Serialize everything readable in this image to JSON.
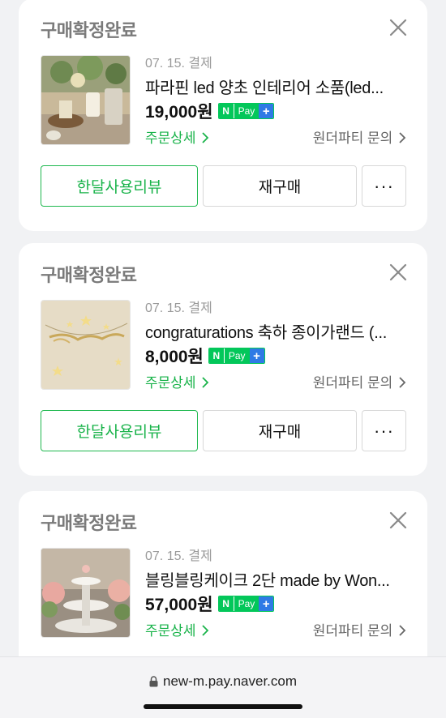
{
  "orders": [
    {
      "status": "구매확정완료",
      "date": "07. 15. 결제",
      "title": "파라핀 led 양초 인테리어 소품(led...",
      "price": "19,000원",
      "detail_link": "주문상세",
      "inquiry_link": "원더파티 문의",
      "review_button": "한달사용리뷰",
      "rebuy_button": "재구매",
      "more_button": "···"
    },
    {
      "status": "구매확정완료",
      "date": "07. 15. 결제",
      "title": "congraturations 축하 종이가랜드 (...",
      "price": "8,000원",
      "detail_link": "주문상세",
      "inquiry_link": "원더파티 문의",
      "review_button": "한달사용리뷰",
      "rebuy_button": "재구매",
      "more_button": "···"
    },
    {
      "status": "구매확정완료",
      "date": "07. 15. 결제",
      "title": "블링블링케이크 2단 made by Won...",
      "price": "57,000원",
      "detail_link": "주문상세",
      "inquiry_link": "원더파티 문의"
    }
  ],
  "npay": {
    "n": "N",
    "pay": "Pay",
    "plus": "+"
  },
  "browser": {
    "url": "new-m.pay.naver.com"
  },
  "colors": {
    "accent": "#19b34a",
    "npay_green": "#03c75a",
    "npay_blue": "#2f7ae5"
  },
  "icons": {
    "close": "close-icon",
    "chevron": "chevron-right-icon",
    "lock": "lock-icon"
  }
}
